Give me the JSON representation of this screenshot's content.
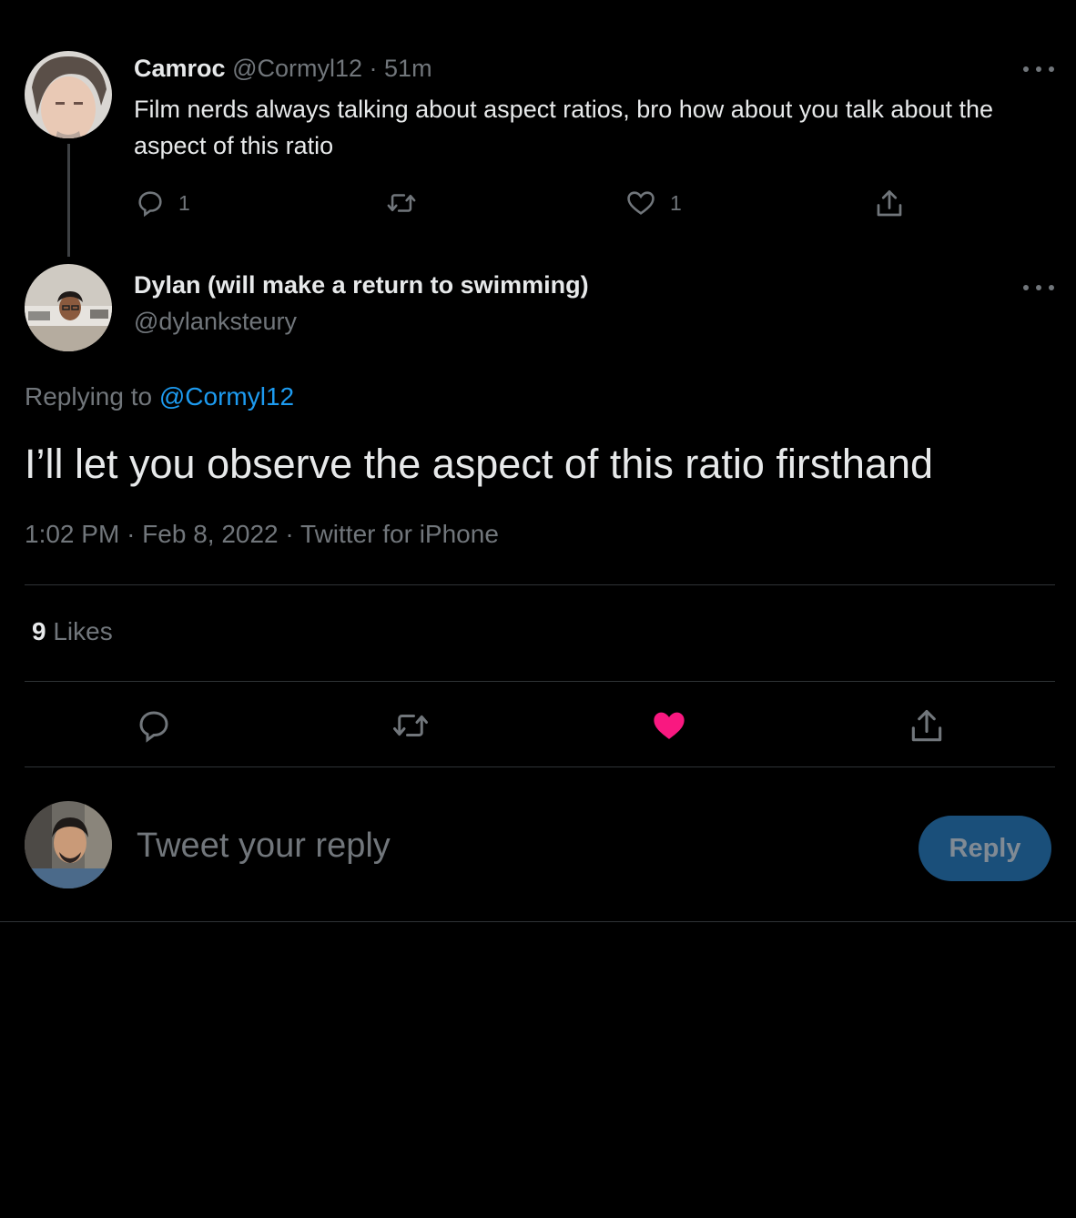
{
  "parent_tweet": {
    "display_name": "Camroc",
    "handle": "@Cormyl12",
    "separator": "·",
    "time_ago": "51m",
    "text": "Film nerds always talking about aspect ratios, bro how about you talk about the aspect of this ratio",
    "reply_count": "1",
    "like_count": "1"
  },
  "main_tweet": {
    "display_name": "Dylan (will make a return to swimming)",
    "handle": "@dylanksteury",
    "replying_prefix": "Replying to",
    "replying_to": "@Cormyl12",
    "text": "I’ll let you observe the aspect of this ratio firsthand",
    "time": "1:02 PM",
    "date": "Feb 8, 2022",
    "source": "Twitter for iPhone",
    "likes_count": "9",
    "likes_label": "Likes",
    "liked": true
  },
  "compose": {
    "placeholder": "Tweet your reply",
    "button_label": "Reply"
  },
  "colors": {
    "background": "#000000",
    "text": "#e7e9ea",
    "muted": "#71767b",
    "link": "#1d9bf0",
    "like_active": "#f91880",
    "reply_button_disabled": "#1a4f7a"
  }
}
